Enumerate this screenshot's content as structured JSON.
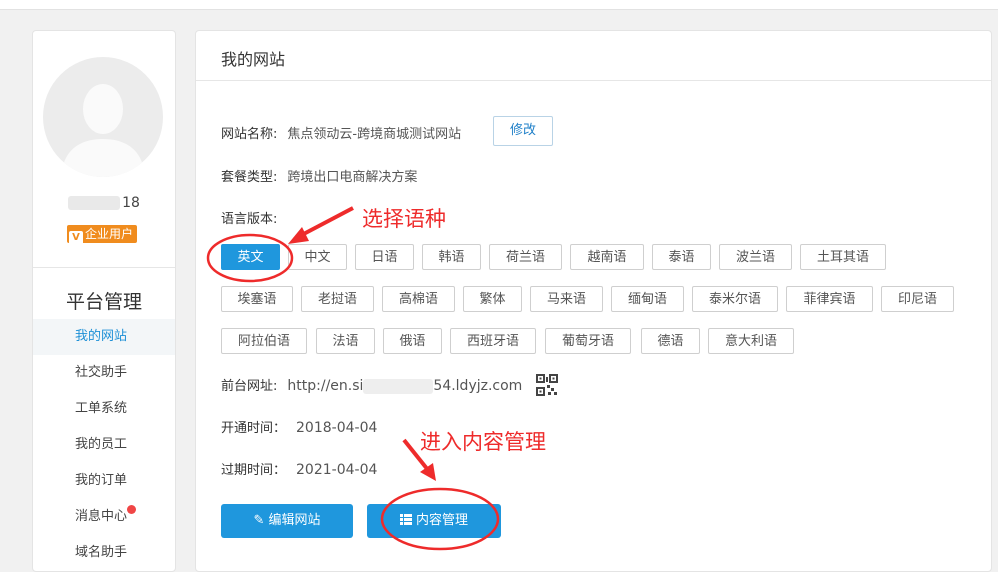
{
  "sidebar": {
    "user_id_suffix": "18",
    "badge_label": "企业用户",
    "section_title": "平台管理",
    "items": [
      {
        "label": "我的网站",
        "active": true
      },
      {
        "label": "社交助手"
      },
      {
        "label": "工单系统"
      },
      {
        "label": "我的员工"
      },
      {
        "label": "我的订单"
      },
      {
        "label": "消息中心",
        "has_dot": true
      },
      {
        "label": "域名助手"
      }
    ]
  },
  "main": {
    "title": "我的网站",
    "site_name_label": "网站名称:",
    "site_name": "焦点领动云-跨境商城测试网站",
    "edit_name_button": "修改",
    "package_label": "套餐类型:",
    "package_value": "跨境出口电商解决方案",
    "language_label": "语言版本:",
    "languages": [
      "英文",
      "中文",
      "日语",
      "韩语",
      "荷兰语",
      "越南语",
      "泰语",
      "波兰语",
      "土耳其语",
      "埃塞语",
      "老挝语",
      "高棉语",
      "繁体",
      "马来语",
      "缅甸语",
      "泰米尔语",
      "菲律宾语",
      "印尼语",
      "阿拉伯语",
      "法语",
      "俄语",
      "西班牙语",
      "葡萄牙语",
      "德语",
      "意大利语"
    ],
    "selected_language": "英文",
    "frontend_url_label": "前台网址:",
    "frontend_url_prefix": "http://en.si",
    "frontend_url_suffix": "54.ldyjz.com",
    "open_time_label": "开通时间：",
    "open_time": "2018-04-04",
    "expire_time_label": "过期时间：",
    "expire_time": "2021-04-04",
    "edit_site_button": "编辑网站",
    "content_manage_button": "内容管理"
  },
  "annotations": {
    "select_language": "选择语种",
    "enter_content": "进入内容管理",
    "color": "#ee2b2b"
  }
}
